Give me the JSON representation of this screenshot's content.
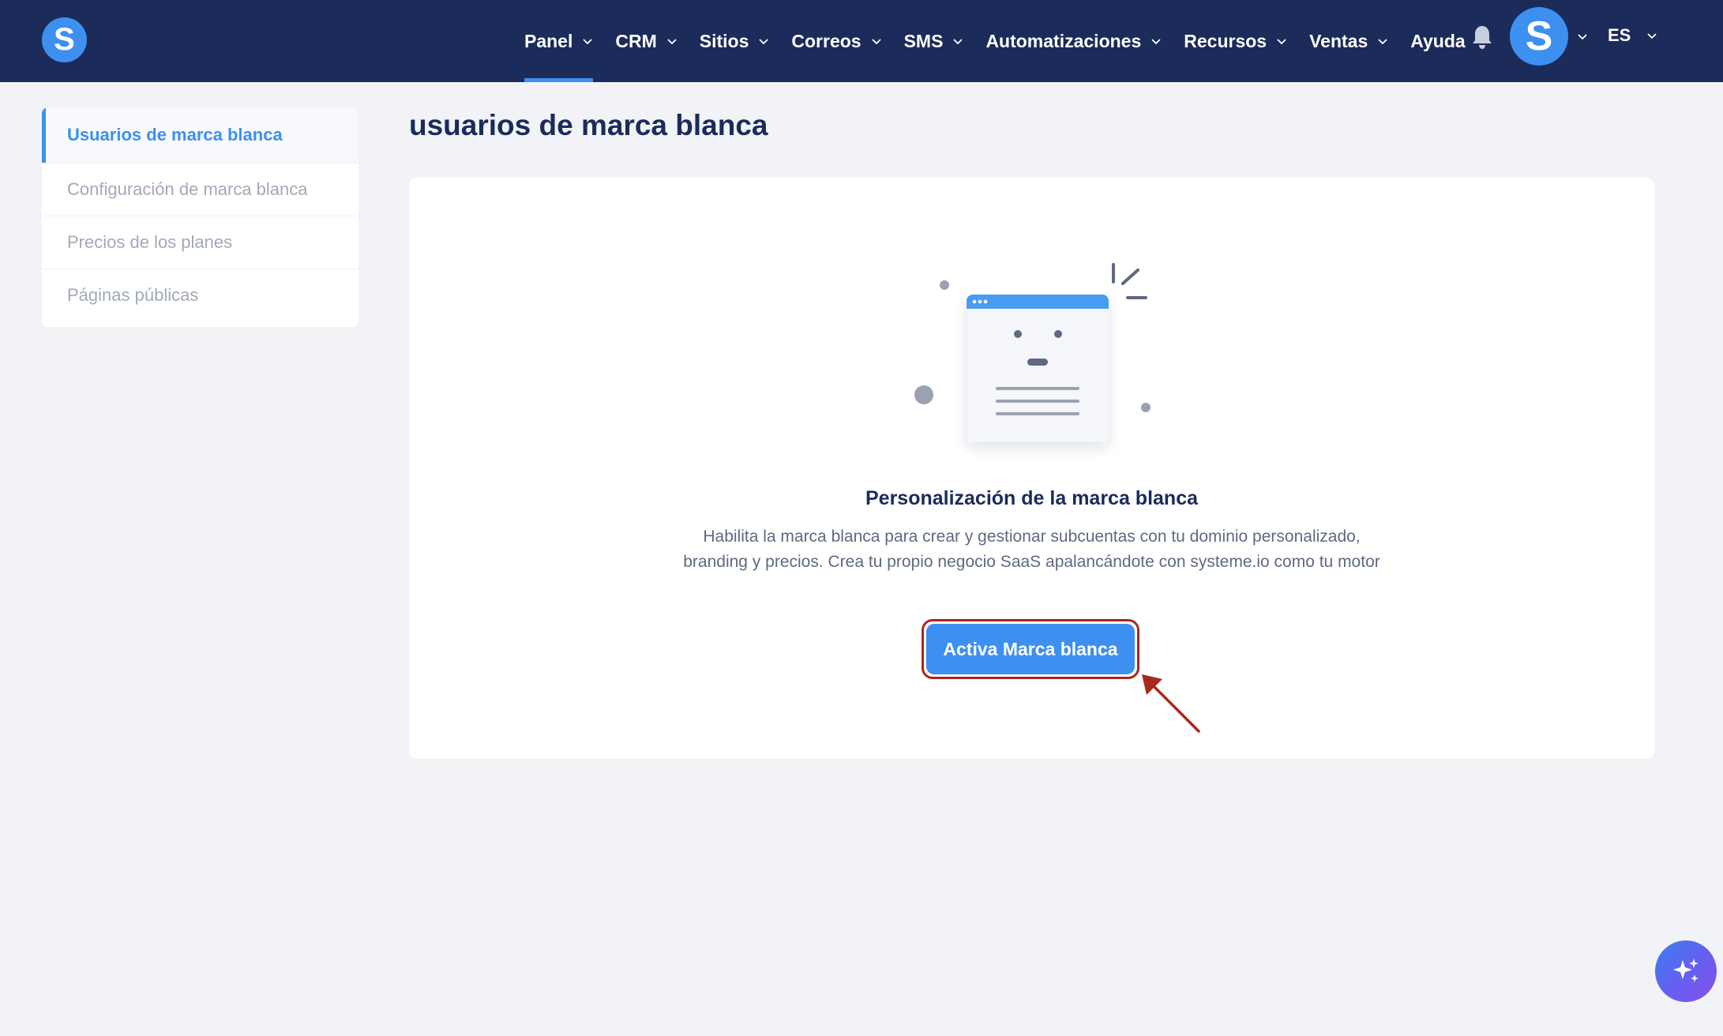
{
  "header": {
    "logo_letter": "S",
    "nav": [
      {
        "label": "Panel",
        "active": true,
        "dropdown": true
      },
      {
        "label": "CRM",
        "active": false,
        "dropdown": true
      },
      {
        "label": "Sitios",
        "active": false,
        "dropdown": true
      },
      {
        "label": "Correos",
        "active": false,
        "dropdown": true
      },
      {
        "label": "SMS",
        "active": false,
        "dropdown": true
      },
      {
        "label": "Automatizaciones",
        "active": false,
        "dropdown": true
      },
      {
        "label": "Recursos",
        "active": false,
        "dropdown": true
      },
      {
        "label": "Ventas",
        "active": false,
        "dropdown": true
      },
      {
        "label": "Ayuda",
        "active": false,
        "dropdown": false
      }
    ],
    "notification_icon": "bell-icon",
    "avatar_letter": "S",
    "language": "ES"
  },
  "sidebar": {
    "items": [
      {
        "label": "Usuarios de marca blanca",
        "active": true
      },
      {
        "label": "Configuración de marca blanca",
        "active": false
      },
      {
        "label": "Precios de los planes",
        "active": false
      },
      {
        "label": "Páginas públicas",
        "active": false
      }
    ]
  },
  "main": {
    "title": "usuarios de marca blanca",
    "empty_state": {
      "illustration": "browser-window-illustration",
      "heading": "Personalización de la marca blanca",
      "description": "Habilita la marca blanca para crear y gestionar subcuentas con tu dominio personalizado, branding y precios. Crea tu propio negocio SaaS apalancándote con systeme.io como tu motor",
      "cta_label": "Activa Marca blanca"
    }
  },
  "floating": {
    "assistant_icon": "sparkles-icon"
  },
  "colors": {
    "topbar": "#1b2b5a",
    "accent": "#3d90f0",
    "background": "#f1f3f7",
    "highlight": "#a8291c"
  }
}
